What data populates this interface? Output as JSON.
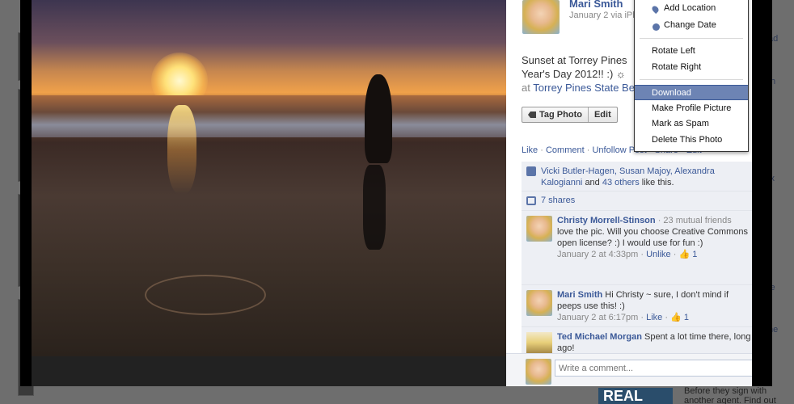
{
  "background": {
    "right_texts": [
      "ad",
      "th",
      "ix",
      "le",
      "ne"
    ],
    "ad_logo": "REAL",
    "ad_text": "Before they sign with another agent. Find out"
  },
  "owner": {
    "name": "Mari Smith",
    "meta": "January 2 via iPl"
  },
  "caption": {
    "line1": "Sunset at Torrey Pines",
    "line2": "Year's Day 2012!! :) ☼",
    "location_prefix": "at",
    "location": "Torrey Pines State Be"
  },
  "photo_actions": {
    "tag_label": "Tag Photo",
    "edit_label": "Edit"
  },
  "actions_line": {
    "like": "Like",
    "comment": "Comment",
    "unfollow": "Unfollow Post",
    "share": "Share",
    "edit": "Edit"
  },
  "likes": {
    "names": "Vicki Butler-Hagen, Susan Majoy, Alexandra Kalogianni",
    "and": "and",
    "others": "43 others",
    "suffix": "like this."
  },
  "shares": {
    "label": "7 shares"
  },
  "comments": [
    {
      "author": "Christy Morrell-Stinson",
      "mutual": "· 23 mutual friends",
      "text": "love the pic. Will you choose Creative Commons open license? :) I would use for fun :)",
      "time": "January 2 at 4:33pm",
      "action": "Unlike",
      "likes": "1"
    },
    {
      "author": "Mari Smith",
      "text": "Hi Christy ~ sure, I don't mind if peeps use this! :)",
      "time": "January 2 at 6:17pm",
      "action": "Like",
      "likes": "1"
    },
    {
      "author": "Ted Michael Morgan",
      "text": "Spent a lot time there, long ago!"
    }
  ],
  "comment_box": {
    "placeholder": "Write a comment..."
  },
  "menu": {
    "add_location": "Add Location",
    "change_date": "Change Date",
    "rotate_left": "Rotate Left",
    "rotate_right": "Rotate Right",
    "download": "Download",
    "make_profile": "Make Profile Picture",
    "mark_spam": "Mark as Spam",
    "delete": "Delete This Photo"
  }
}
